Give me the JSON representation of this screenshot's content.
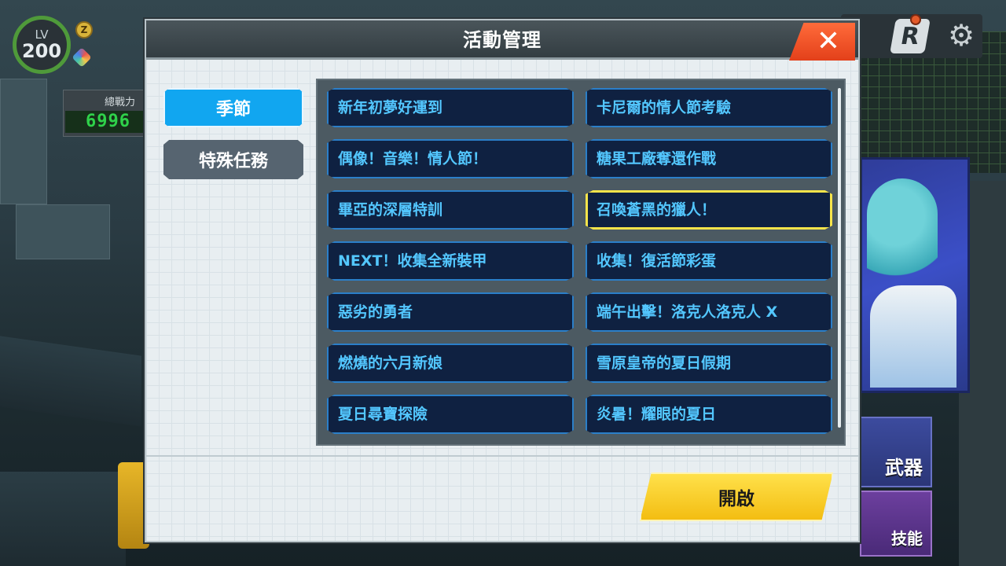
{
  "hud": {
    "level_label": "LV",
    "level_value": "200",
    "power_label": "總戰力",
    "power_value": "6996",
    "weapon_label": "武器",
    "skill_label": "技能",
    "r_icon_glyph": "R"
  },
  "dialog": {
    "title": "活動管理",
    "close_glyph": "✕",
    "tabs": [
      {
        "label": "季節",
        "active": true
      },
      {
        "label": "特殊任務",
        "active": false
      }
    ],
    "events": [
      {
        "label": "新年初夢好運到",
        "selected": false
      },
      {
        "label": "卡尼爾的情人節考驗",
        "selected": false
      },
      {
        "label": "偶像！音樂！情人節！",
        "selected": false
      },
      {
        "label": "糖果工廠奪還作戰",
        "selected": false
      },
      {
        "label": "畢亞的深層特訓",
        "selected": false
      },
      {
        "label": "召喚蒼黑的獵人！",
        "selected": true
      },
      {
        "label": "NEXT！收集全新裝甲",
        "selected": false
      },
      {
        "label": "收集！復活節彩蛋",
        "selected": false
      },
      {
        "label": "惡劣的勇者",
        "selected": false
      },
      {
        "label": "端午出擊！洛克人洛克人 X",
        "selected": false
      },
      {
        "label": "燃燒的六月新娘",
        "selected": false
      },
      {
        "label": "雪原皇帝的夏日假期",
        "selected": false
      },
      {
        "label": "夏日尋寶探險",
        "selected": false
      },
      {
        "label": "炎暑！耀眼的夏日",
        "selected": false
      }
    ],
    "open_button_label": "開啟"
  },
  "colors": {
    "accent_active_tab": "#11a6f0",
    "event_text": "#53c7ff",
    "selected_border": "#f6e44a",
    "open_button": "#f3bd12",
    "close_button": "#e3401a"
  }
}
